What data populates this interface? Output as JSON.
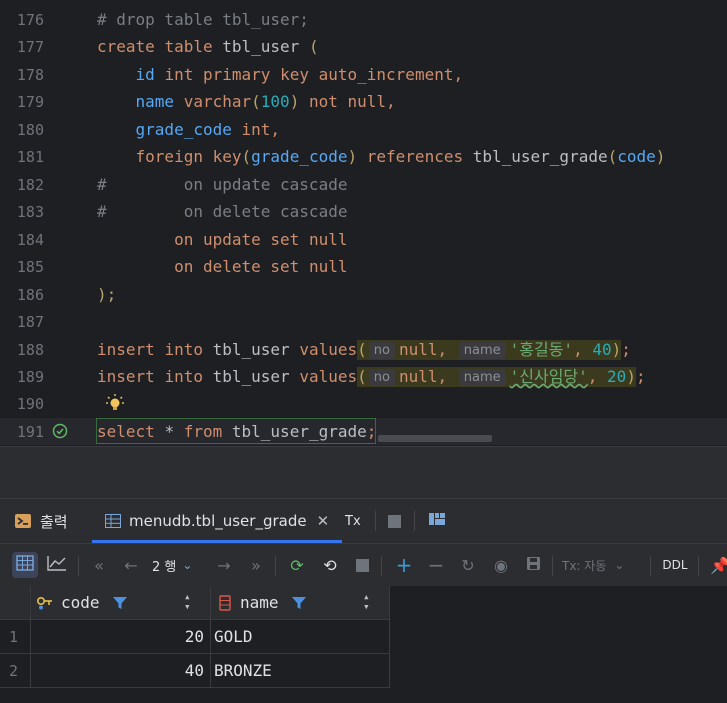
{
  "editor": {
    "lines": [
      {
        "no": "176"
      },
      {
        "no": "177"
      },
      {
        "no": "178"
      },
      {
        "no": "179"
      },
      {
        "no": "180"
      },
      {
        "no": "181"
      },
      {
        "no": "182"
      },
      {
        "no": "183"
      },
      {
        "no": "184"
      },
      {
        "no": "185"
      },
      {
        "no": "186"
      },
      {
        "no": "187"
      },
      {
        "no": "188"
      },
      {
        "no": "189"
      },
      {
        "no": "190"
      },
      {
        "no": "191"
      }
    ],
    "text": {
      "l176": "# drop table tbl_user;",
      "create": "create",
      "table": "table",
      "tbl_user": "tbl_user",
      "open_paren": "(",
      "id": "id",
      "int": "int",
      "primary": "primary",
      "key": "key",
      "auto_increment": "auto_increment",
      "comma": ",",
      "name": "name",
      "varchar": "varchar",
      "n100": "100",
      "not": "not",
      "null": "null",
      "grade_code": "grade_code",
      "foreign": "foreign",
      "references": "references",
      "tbl_user_grade": "tbl_user_grade",
      "code": "code",
      "l182_hash": "#",
      "l182_rest": "on update cascade",
      "l183_hash": "#",
      "l183_rest": "on delete cascade",
      "on": "on",
      "update": "update",
      "delete": "delete",
      "set": "set",
      "close_stmt": ");",
      "insert": "insert",
      "into": "into",
      "values": "values",
      "hint_no": "no",
      "hint_name": "name",
      "str1": "'홍길동'",
      "n40": "40",
      "str2": "'신사임당'",
      "n20": "20",
      "select": "select",
      "star": "*",
      "from": "from",
      "semi": ";"
    }
  },
  "panel": {
    "tabs": [
      {
        "label": "출력"
      },
      {
        "label": "menudb.tbl_user_grade"
      }
    ],
    "tx_label": "Tx",
    "toolbar": {
      "rows_label": "2 행",
      "tx_mode": "Tx: 자동",
      "ddl": "DDL"
    },
    "grid": {
      "columns": [
        {
          "name": "code"
        },
        {
          "name": "name"
        }
      ],
      "rows": [
        {
          "num": "1",
          "code": "20",
          "name": "GOLD"
        },
        {
          "num": "2",
          "code": "40",
          "name": "BRONZE"
        }
      ]
    }
  }
}
